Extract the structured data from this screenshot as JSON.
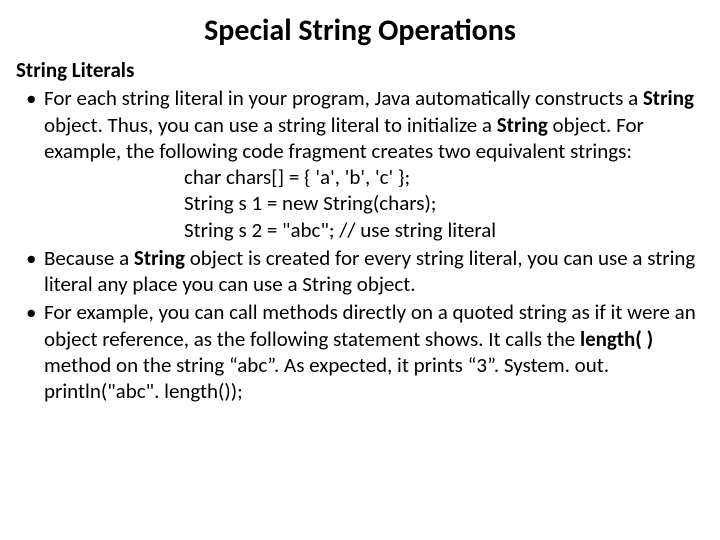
{
  "title": "Special String Operations",
  "subheading": "String Literals",
  "bullet1_part1": "For each string literal in your program, Java automatically constructs a ",
  "bullet1_bold1": "String",
  "bullet1_part2": " object. Thus, you can use a string literal to initialize a ",
  "bullet1_bold2": "String",
  "bullet1_part3": " object. For example, the following code fragment creates two equivalent strings:",
  "code1": "char chars[] = { 'a', 'b', 'c' };",
  "code2": "String s 1 = new String(chars);",
  "code3": "String s 2 = \"abc\"; // use string literal",
  "bullet2_part1": "Because a ",
  "bullet2_bold1": "String",
  "bullet2_part2": " object is created for every string literal, you can use a string literal any place you can use a String object.",
  "bullet3_part1": "For example, you can call methods directly on a quoted string as if it were an object reference, as the following statement shows. It calls the ",
  "bullet3_bold1": "length( )",
  "bullet3_part2": " method on the string “abc”. As expected, it prints “3”. System. out. println(\"abc\". length());"
}
